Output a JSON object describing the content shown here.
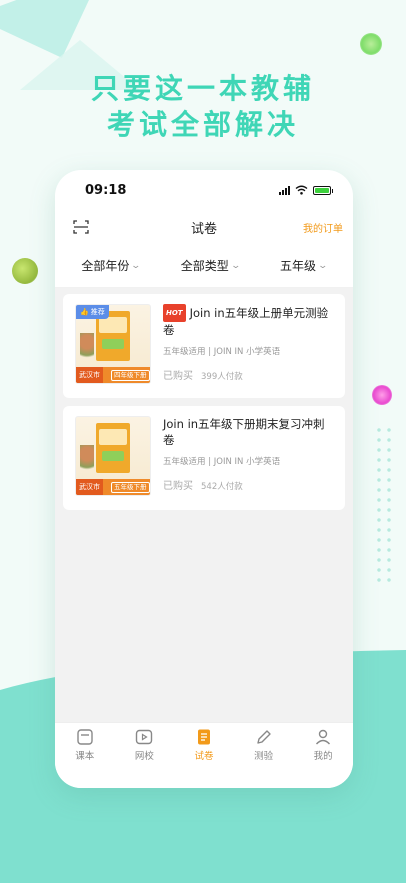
{
  "headline": {
    "line1": "只要这一本教辅",
    "line2": "考试全部解决"
  },
  "status_bar": {
    "time": "09:18"
  },
  "nav": {
    "title": "试卷",
    "orders_link": "我的订单"
  },
  "filters": [
    {
      "label": "全部年份"
    },
    {
      "label": "全部类型"
    },
    {
      "label": "五年级"
    }
  ],
  "papers": [
    {
      "badge": "HOT",
      "recommend_tag": "推荐",
      "title": "Join in五年级上册单元测验卷",
      "meta": "五年级适用 | JOIN IN 小学英语",
      "purchased": "已购买",
      "paid_count": "399人付款",
      "cover_city": "武汉市",
      "cover_grade": "四年级下册"
    },
    {
      "badge": "",
      "recommend_tag": "",
      "title": "Join in五年级下册期末复习冲刺卷",
      "meta": "五年级适用 | JOIN IN 小学英语",
      "purchased": "已购买",
      "paid_count": "542人付款",
      "cover_city": "武汉市",
      "cover_grade": "五年级下册"
    }
  ],
  "tabbar": [
    {
      "label": "课本",
      "icon": "book-icon",
      "active": false
    },
    {
      "label": "网校",
      "icon": "video-icon",
      "active": false
    },
    {
      "label": "试卷",
      "icon": "paper-icon",
      "active": true
    },
    {
      "label": "测验",
      "icon": "pencil-icon",
      "active": false
    },
    {
      "label": "我的",
      "icon": "user-icon",
      "active": false
    }
  ],
  "colors": {
    "accent": "#f29a1a",
    "headline": "#3fd6b6",
    "hot": "#e8412b",
    "background_wave": "#7fe0cf"
  }
}
